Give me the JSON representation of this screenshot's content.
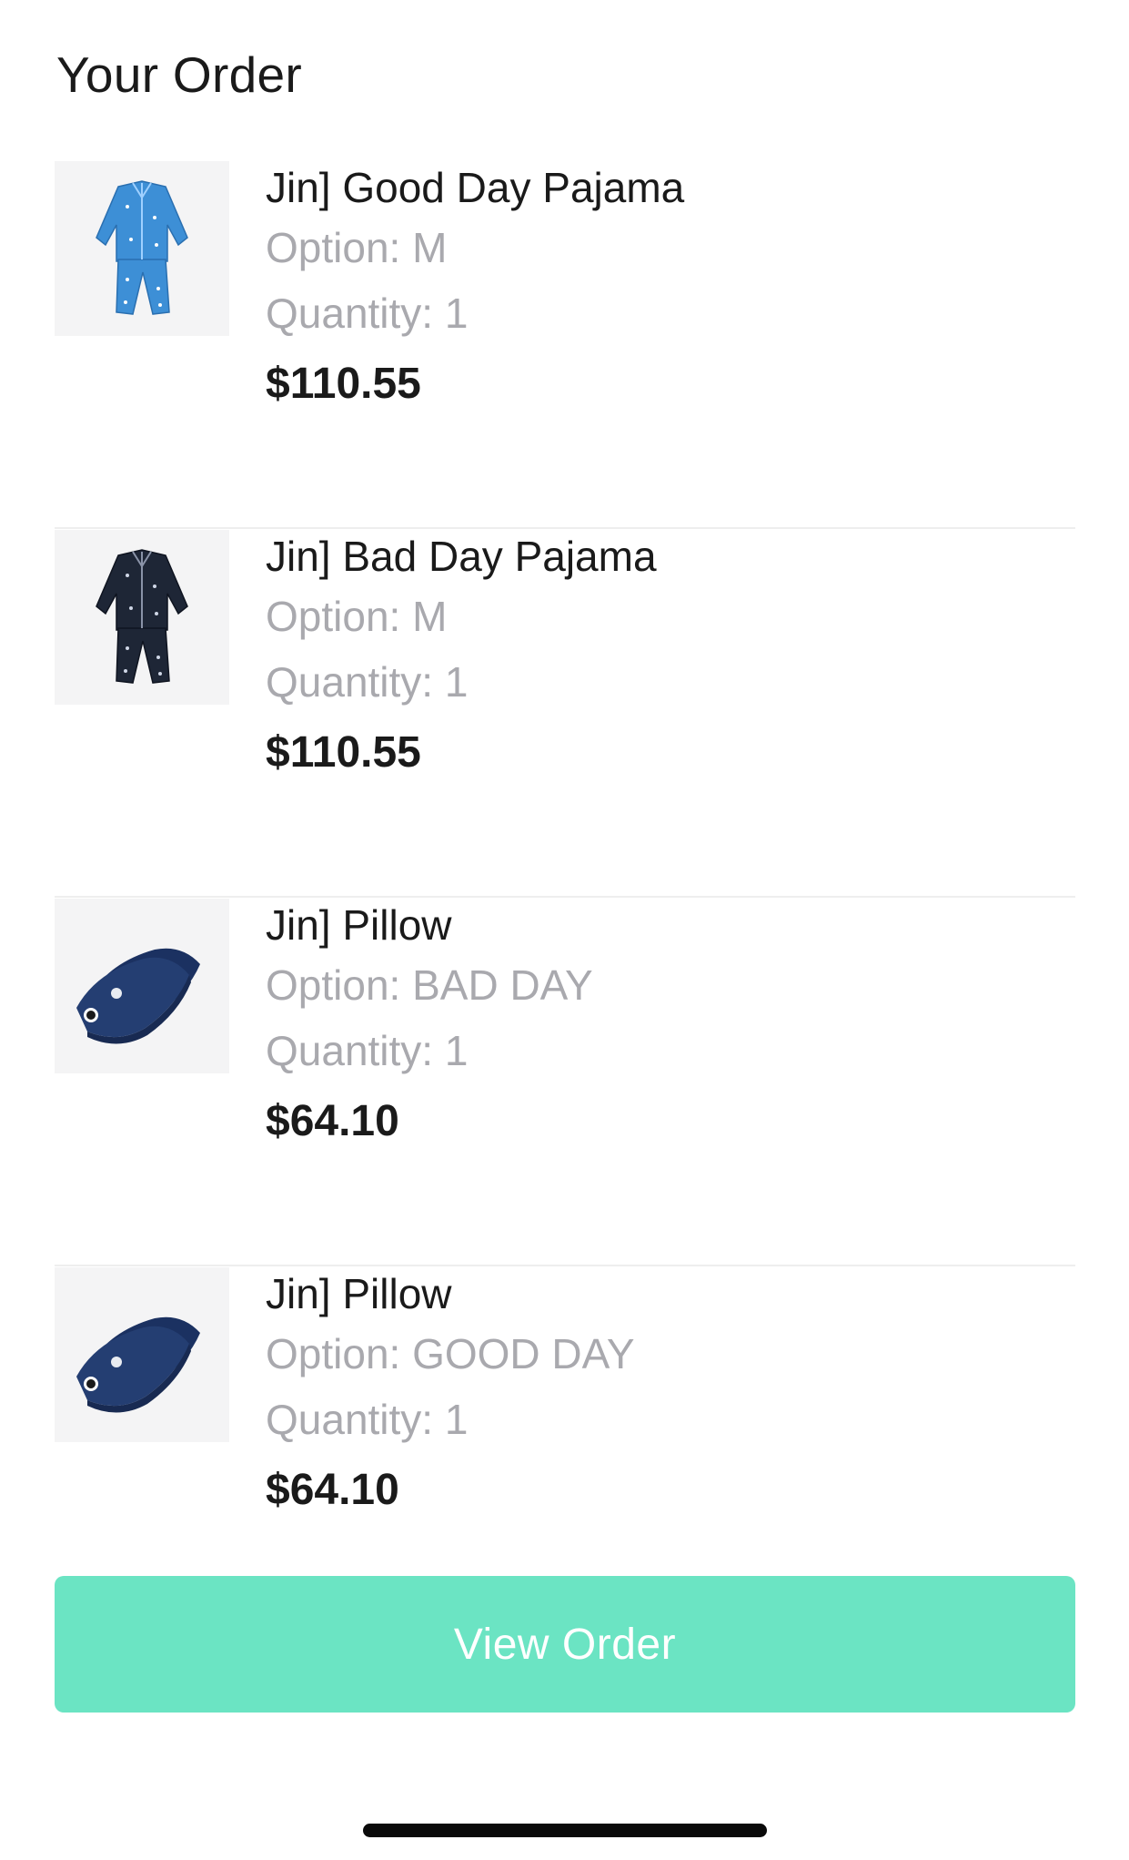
{
  "header": {
    "title": "Your Order"
  },
  "order": {
    "items": [
      {
        "name": "Jin] Good Day Pajama",
        "option": "Option: M",
        "quantity": "Quantity: 1",
        "price": "$110.55",
        "image_icon": "blue-pajama-icon"
      },
      {
        "name": "Jin] Bad Day Pajama",
        "option": "Option: M",
        "quantity": "Quantity: 1",
        "price": "$110.55",
        "image_icon": "navy-pajama-icon"
      },
      {
        "name": "Jin] Pillow",
        "option": "Option: BAD DAY",
        "quantity": "Quantity: 1",
        "price": "$64.10",
        "image_icon": "pillow-icon"
      },
      {
        "name": "Jin] Pillow",
        "option": "Option: GOOD DAY",
        "quantity": "Quantity: 1",
        "price": "$64.10",
        "image_icon": "pillow-icon"
      }
    ]
  },
  "actions": {
    "view_order_label": "View Order"
  },
  "colors": {
    "accent": "#6be4c3",
    "muted_text": "#a9a9ae",
    "thumb_bg": "#f4f4f5",
    "good_day_pajama": "#3d8fd6",
    "bad_day_pajama": "#1e2636",
    "pillow": "#243e72"
  }
}
